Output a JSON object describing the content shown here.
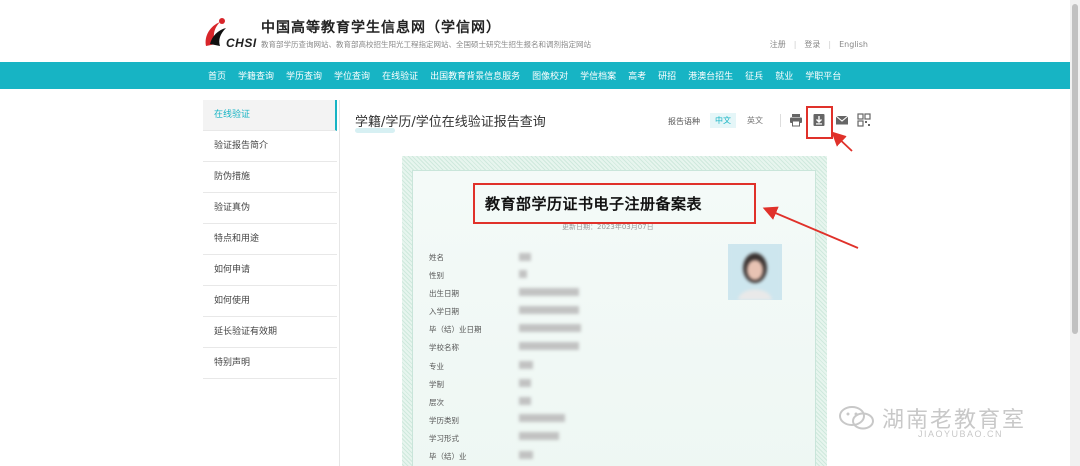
{
  "header": {
    "logo_text": "CHSI",
    "site_title": "中国高等教育学生信息网（学信网）",
    "site_subtitle": "教育部学历查询网站、教育部高校招生阳光工程指定网站、全国硕士研究生招生报名和调剂指定网站",
    "links": [
      "注册",
      "登录",
      "English"
    ]
  },
  "nav": [
    "首页",
    "学籍查询",
    "学历查询",
    "学位查询",
    "在线验证",
    "出国教育背景信息服务",
    "图像校对",
    "学信档案",
    "高考",
    "研招",
    "港澳台招生",
    "征兵",
    "就业",
    "学职平台"
  ],
  "sidebar": [
    "在线验证",
    "验证报告简介",
    "防伪措施",
    "验证真伪",
    "特点和用途",
    "如何申请",
    "如何使用",
    "延长验证有效期",
    "特别声明"
  ],
  "main": {
    "title": "学籍/学历/学位在线验证报告查询",
    "lang_label": "报告语种",
    "lang_cn": "中文",
    "lang_en": "英文"
  },
  "certificate": {
    "title": "教育部学历证书电子注册备案表",
    "date": "更新日期：2023年03月07日",
    "fields": [
      "姓名",
      "性别",
      "出生日期",
      "入学日期",
      "毕（结）业日期",
      "学校名称",
      "专业",
      "学制",
      "层次",
      "学历类别",
      "学习形式",
      "毕（结）业"
    ]
  },
  "watermark": {
    "text": "湖南老教育室",
    "domain": "JIAOYUBAO.CN"
  },
  "colors": {
    "accent": "#17b4c4",
    "annotation": "#e0312a"
  }
}
